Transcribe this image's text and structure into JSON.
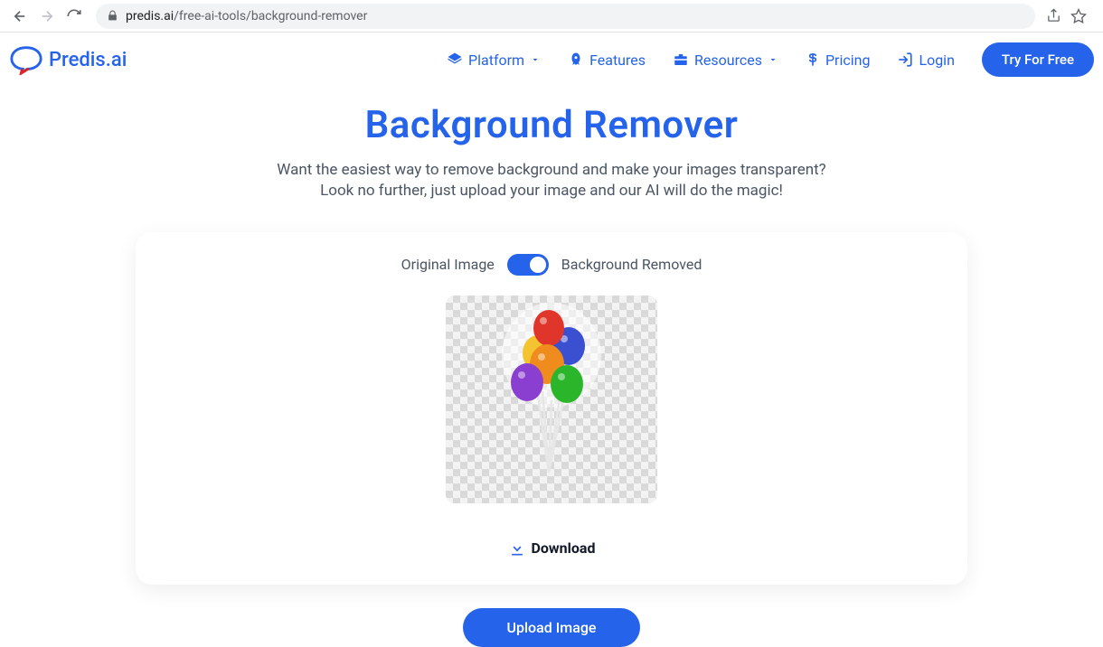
{
  "browser": {
    "url_domain": "predis.ai",
    "url_path": "/free-ai-tools/background-remover"
  },
  "header": {
    "brand": "Predis.ai",
    "nav": {
      "platform": "Platform",
      "features": "Features",
      "resources": "Resources",
      "pricing": "Pricing",
      "login": "Login",
      "try": "Try For Free"
    }
  },
  "hero": {
    "title": "Background Remover",
    "subtitle_line1": "Want the easiest way to remove background and make your images transparent?",
    "subtitle_line2": "Look no further, just upload your image and our AI will do the magic!"
  },
  "card": {
    "toggle_left": "Original Image",
    "toggle_right": "Background Removed",
    "download": "Download"
  },
  "actions": {
    "upload": "Upload Image"
  }
}
